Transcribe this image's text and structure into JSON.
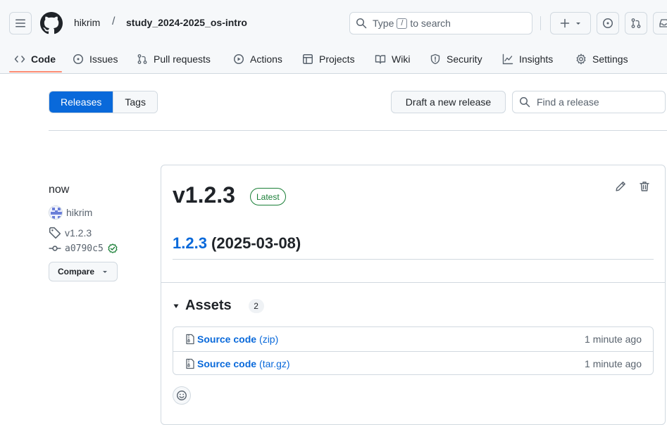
{
  "header": {
    "owner": "hikrim",
    "separator": "/",
    "repo": "study_2024-2025_os-intro",
    "search": {
      "prefix": "Type",
      "key": "/",
      "suffix": "to search"
    },
    "new_button_label": "+"
  },
  "tabs": [
    {
      "label": "Code",
      "icon": "code-icon",
      "active": true
    },
    {
      "label": "Issues",
      "icon": "issue-opened-icon"
    },
    {
      "label": "Pull requests",
      "icon": "git-pull-request-icon"
    },
    {
      "label": "Actions",
      "icon": "play-icon"
    },
    {
      "label": "Projects",
      "icon": "table-icon"
    },
    {
      "label": "Wiki",
      "icon": "book-icon"
    },
    {
      "label": "Security",
      "icon": "shield-icon"
    },
    {
      "label": "Insights",
      "icon": "graph-icon"
    },
    {
      "label": "Settings",
      "icon": "gear-icon"
    }
  ],
  "subnav": {
    "releases_label": "Releases",
    "tags_label": "Tags",
    "draft_button": "Draft a new release",
    "find_placeholder": "Find a release"
  },
  "release": {
    "time": "now",
    "author": "hikrim",
    "tag": "v1.2.3",
    "commit": "a0790c5",
    "compare_label": "Compare",
    "title": "v1.2.3",
    "badge": "Latest",
    "body_link": "1.2.3",
    "body_rest": " (2025-03-08)",
    "assets_label": "Assets",
    "assets_count": "2",
    "assets": [
      {
        "name": "Source code",
        "ext": "(zip)",
        "time": "1 minute ago"
      },
      {
        "name": "Source code",
        "ext": "(tar.gz)",
        "time": "1 minute ago"
      }
    ]
  },
  "colors": {
    "accent": "#0969da",
    "success": "#1a7f37",
    "tab_underline": "#fd8c73",
    "border": "#d1d9e0"
  }
}
